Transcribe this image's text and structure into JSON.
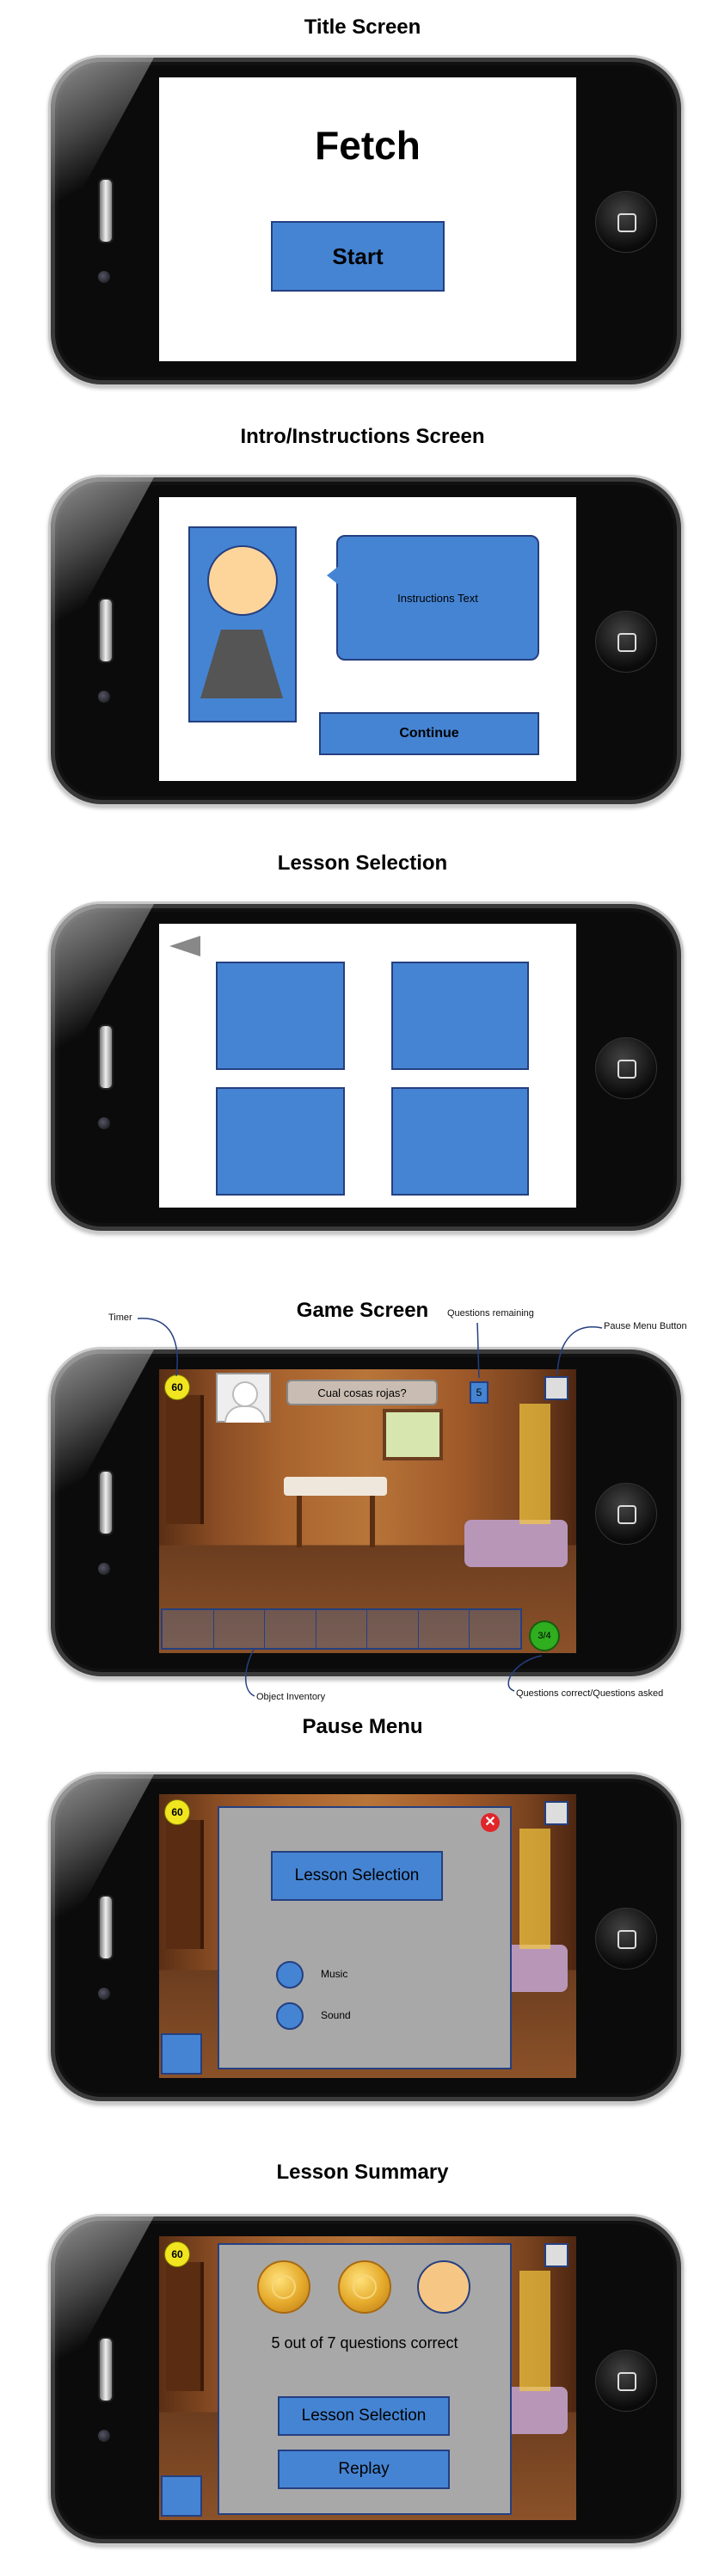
{
  "sections": {
    "title_screen": {
      "heading": "Title Screen",
      "app_title": "Fetch",
      "start_label": "Start"
    },
    "intro": {
      "heading": "Intro/Instructions Screen",
      "instructions_text": "Instructions Text",
      "continue_label": "Continue"
    },
    "lesson_selection": {
      "heading": "Lesson Selection",
      "back_icon": "triangle-left-icon"
    },
    "game": {
      "heading": "Game Screen",
      "timer_value": "60",
      "question": "Cual cosas rojas?",
      "questions_remaining": "5",
      "score": "3/4",
      "annotations": {
        "timer": "Timer",
        "questions_remaining": "Questions remaining",
        "pause_menu_button": "Pause Menu Button",
        "object_inventory": "Object Inventory",
        "questions_correct": "Questions correct/Questions asked"
      }
    },
    "pause": {
      "heading": "Pause Menu",
      "timer_value": "60",
      "lesson_selection_label": "Lesson Selection",
      "music_label": "Music",
      "sound_label": "Sound",
      "close_icon": "close-icon"
    },
    "summary": {
      "heading": "Lesson Summary",
      "timer_value": "60",
      "result_text": "5 out of 7 questions correct",
      "lesson_selection_label": "Lesson Selection",
      "replay_label": "Replay"
    }
  },
  "colors": {
    "button_blue": "#4584d3",
    "button_border": "#253f80",
    "panel_grey": "#a8a8a8",
    "timer_yellow": "#f0e51f",
    "score_green": "#2fae1f",
    "close_red": "#e0262b"
  }
}
